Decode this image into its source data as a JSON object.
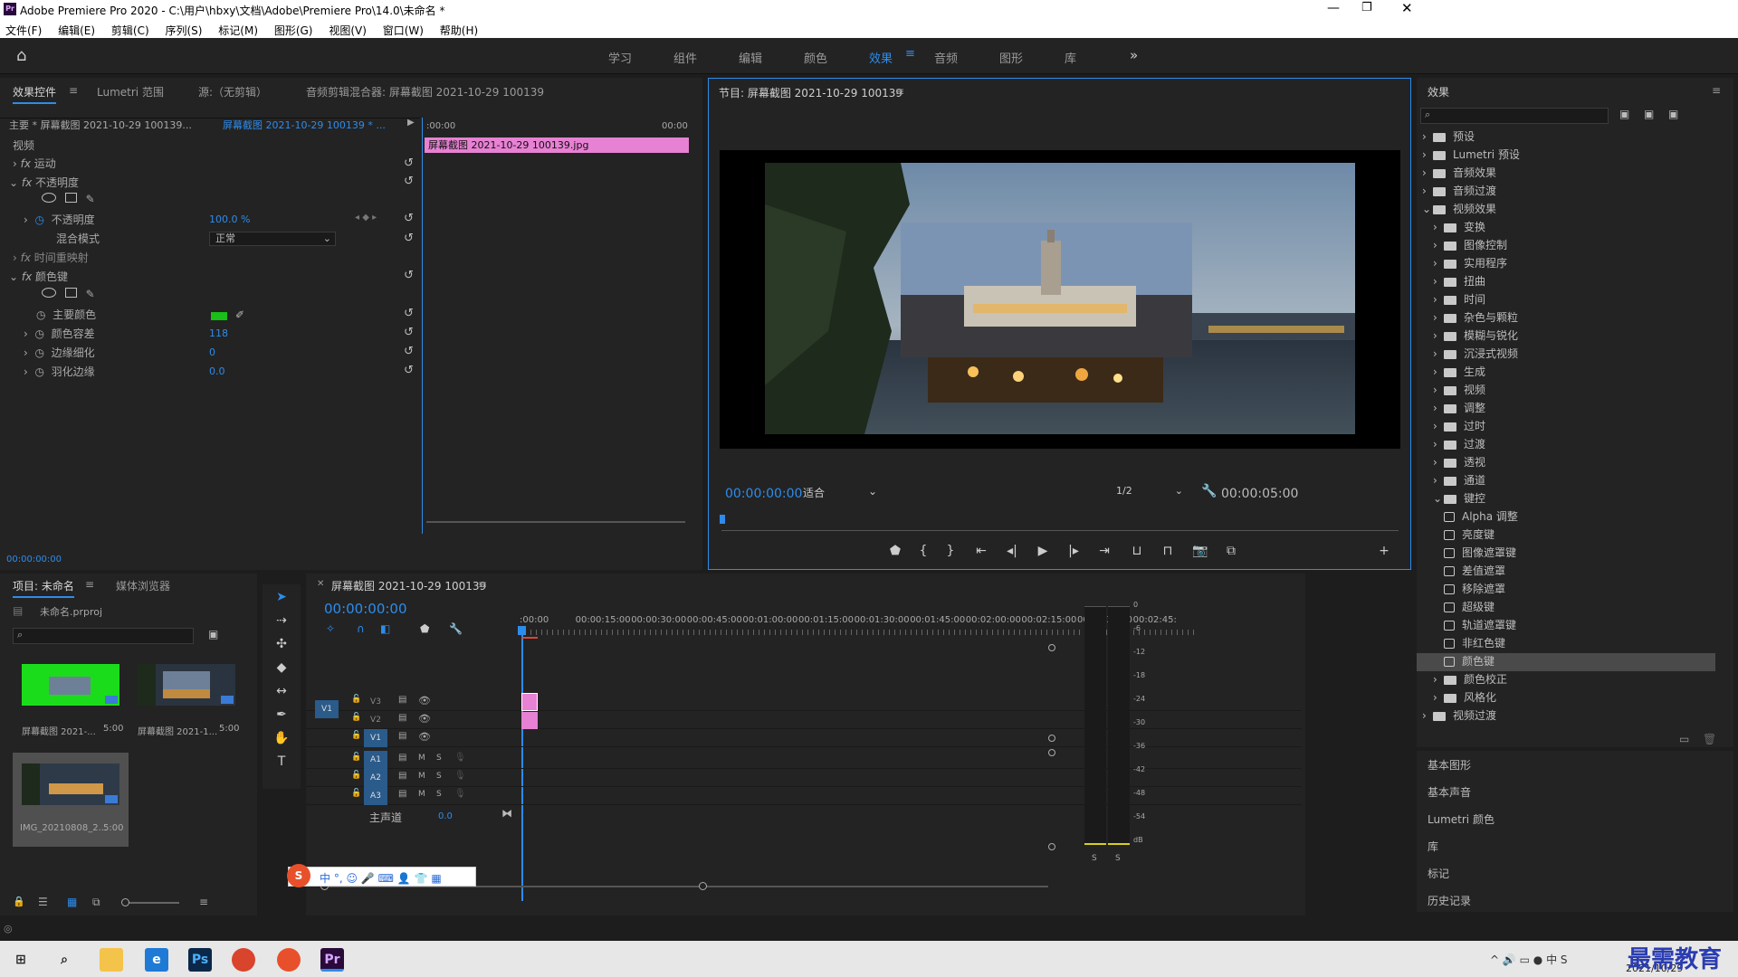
{
  "window": {
    "title": "Adobe Premiere Pro 2020 - C:\\用户\\hbxy\\文档\\Adobe\\Premiere Pro\\14.0\\未命名 *",
    "app_icon": "Pr"
  },
  "menu": [
    "文件(F)",
    "编辑(E)",
    "剪辑(C)",
    "序列(S)",
    "标记(M)",
    "图形(G)",
    "视图(V)",
    "窗口(W)",
    "帮助(H)"
  ],
  "workspaces": [
    "学习",
    "组件",
    "编辑",
    "颜色",
    "效果",
    "音频",
    "图形",
    "库"
  ],
  "active_workspace": "效果",
  "effect_controls": {
    "tabs": [
      "效果控件",
      "Lumetri 范围",
      "源:（无剪辑）",
      "音频剪辑混合器: 屏幕截图 2021-10-29 100139"
    ],
    "master_clip": "主要 * 屏幕截图 2021-10-29 100139...",
    "seq_clip": "屏幕截图 2021-10-29 100139 * ...",
    "time_start": ":00:00",
    "time_end": "00:00",
    "clip_bar": "屏幕截图 2021-10-29 100139.jpg",
    "section_video": "视频",
    "motion": "运动",
    "opacity": "不透明度",
    "opacity_param": "不透明度",
    "opacity_value": "100.0 %",
    "blend_mode_label": "混合模式",
    "blend_mode_value": "正常",
    "time_remap": "时间重映射",
    "color_key": "颜色键",
    "key_color_label": "主要颜色",
    "key_color": "#18c018",
    "color_tolerance_label": "颜色容差",
    "color_tolerance_value": "118",
    "edge_thin_label": "边缘细化",
    "edge_thin_value": "0",
    "feather_label": "羽化边缘",
    "feather_value": "0.0",
    "timecode": "00:00:00:00"
  },
  "program": {
    "title": "节目: 屏幕截图 2021-10-29 100139",
    "timecode": "00:00:00:00",
    "fit": "适合",
    "resolution": "1/2",
    "duration": "00:00:05:00"
  },
  "effects": {
    "title": "效果",
    "search_placeholder": "",
    "tree": [
      {
        "label": "预设",
        "type": "folder-star",
        "level": 0,
        "open": false
      },
      {
        "label": "Lumetri 预设",
        "type": "folder-star",
        "level": 0,
        "open": false
      },
      {
        "label": "音频效果",
        "type": "folder",
        "level": 0,
        "open": false
      },
      {
        "label": "音频过渡",
        "type": "folder",
        "level": 0,
        "open": false
      },
      {
        "label": "视频效果",
        "type": "folder",
        "level": 0,
        "open": true
      },
      {
        "label": "变换",
        "type": "folder",
        "level": 1,
        "open": false
      },
      {
        "label": "图像控制",
        "type": "folder",
        "level": 1,
        "open": false
      },
      {
        "label": "实用程序",
        "type": "folder",
        "level": 1,
        "open": false
      },
      {
        "label": "扭曲",
        "type": "folder",
        "level": 1,
        "open": false
      },
      {
        "label": "时间",
        "type": "folder",
        "level": 1,
        "open": false
      },
      {
        "label": "杂色与颗粒",
        "type": "folder",
        "level": 1,
        "open": false
      },
      {
        "label": "模糊与锐化",
        "type": "folder",
        "level": 1,
        "open": false
      },
      {
        "label": "沉浸式视频",
        "type": "folder",
        "level": 1,
        "open": false
      },
      {
        "label": "生成",
        "type": "folder",
        "level": 1,
        "open": false
      },
      {
        "label": "视频",
        "type": "folder",
        "level": 1,
        "open": false
      },
      {
        "label": "调整",
        "type": "folder",
        "level": 1,
        "open": false
      },
      {
        "label": "过时",
        "type": "folder",
        "level": 1,
        "open": false
      },
      {
        "label": "过渡",
        "type": "folder",
        "level": 1,
        "open": false
      },
      {
        "label": "透视",
        "type": "folder",
        "level": 1,
        "open": false
      },
      {
        "label": "通道",
        "type": "folder",
        "level": 1,
        "open": false
      },
      {
        "label": "键控",
        "type": "folder",
        "level": 1,
        "open": true
      },
      {
        "label": "Alpha 调整",
        "type": "effect",
        "level": 2
      },
      {
        "label": "亮度键",
        "type": "effect",
        "level": 2
      },
      {
        "label": "图像遮罩键",
        "type": "effect",
        "level": 2
      },
      {
        "label": "差值遮罩",
        "type": "effect",
        "level": 2
      },
      {
        "label": "移除遮罩",
        "type": "effect",
        "level": 2
      },
      {
        "label": "超级键",
        "type": "effect",
        "level": 2
      },
      {
        "label": "轨道遮罩键",
        "type": "effect",
        "level": 2
      },
      {
        "label": "非红色键",
        "type": "effect",
        "level": 2
      },
      {
        "label": "颜色键",
        "type": "effect",
        "level": 2,
        "selected": true
      },
      {
        "label": "颜色校正",
        "type": "folder",
        "level": 1,
        "open": false
      },
      {
        "label": "风格化",
        "type": "folder",
        "level": 1,
        "open": false
      },
      {
        "label": "视频过渡",
        "type": "folder",
        "level": 0,
        "open": false
      }
    ],
    "collapsed_panels": [
      "基本图形",
      "基本声音",
      "Lumetri 颜色",
      "库",
      "标记",
      "历史记录"
    ]
  },
  "project": {
    "tabs": [
      "项目: 未命名",
      "媒体浏览器"
    ],
    "file": "未命名.prproj",
    "items": [
      {
        "name": "屏幕截图 2021-...",
        "dur": "5:00"
      },
      {
        "name": "屏幕截图 2021-1...",
        "dur": "5:00"
      },
      {
        "name": "IMG_20210808_2...",
        "dur": "5:00"
      }
    ]
  },
  "timeline": {
    "tab": "屏幕截图 2021-10-29 100139",
    "timecode": "00:00:00:00",
    "ruler": [
      ":00:00",
      "00:00:15:00",
      "00:00:30:00",
      "00:00:45:00",
      "00:01:00:00",
      "00:01:15:00",
      "00:01:30:00",
      "00:01:45:00",
      "00:02:00:00",
      "00:02:15:00",
      "00:02:30:00",
      "00:02:45:"
    ],
    "video_tracks": [
      "V3",
      "V2",
      "V1"
    ],
    "audio_tracks": [
      "A1",
      "A2",
      "A3"
    ],
    "source_patch": "V1",
    "master_label": "主声道",
    "master_value": "0.0",
    "track_m": "M",
    "track_s": "S"
  },
  "meter": {
    "scale": [
      "0",
      "-6",
      "-12",
      "-18",
      "-24",
      "-30",
      "-36",
      "-42",
      "-48",
      "-54",
      "dB"
    ],
    "solo": [
      "S",
      "S"
    ]
  },
  "ime_bar": [
    "中",
    "°,",
    "☺",
    "🎤",
    "⌨",
    "👤",
    "👕",
    "▦"
  ],
  "taskbar": {
    "time": "2021/10/29",
    "watermark": "最需教育"
  }
}
